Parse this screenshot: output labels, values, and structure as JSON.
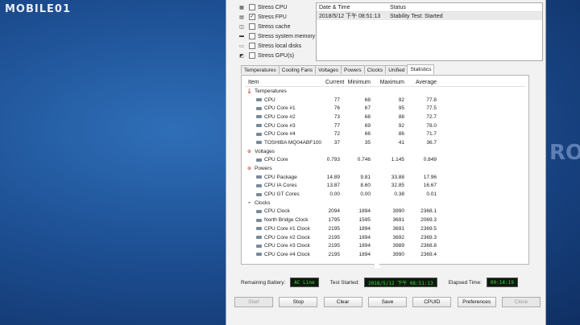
{
  "watermark": "MOBILE01",
  "bg_logo": "RO",
  "options": [
    {
      "label": "Stress CPU",
      "checked": false,
      "icon": "cpu-icon"
    },
    {
      "label": "Stress FPU",
      "checked": true,
      "icon": "fpu-icon"
    },
    {
      "label": "Stress cache",
      "checked": false,
      "icon": "cache-icon"
    },
    {
      "label": "Stress system memory",
      "checked": false,
      "icon": "memory-icon"
    },
    {
      "label": "Stress local disks",
      "checked": false,
      "icon": "disk-icon"
    },
    {
      "label": "Stress GPU(s)",
      "checked": false,
      "icon": "gpu-icon"
    }
  ],
  "log": {
    "col_date": "Date & Time",
    "col_status": "Status",
    "rows": [
      {
        "date": "2018/5/12 下午 08:51:13",
        "status": "Stability Test: Started"
      }
    ]
  },
  "tabs": [
    "Temperatures",
    "Cooling Fans",
    "Voltages",
    "Powers",
    "Clocks",
    "Unified",
    "Statistics"
  ],
  "active_tab": "Statistics",
  "table": {
    "headers": [
      "Item",
      "Current",
      "Minimum",
      "Maximum",
      "Average"
    ],
    "rows": [
      {
        "type": "group",
        "name": "Temperatures",
        "icon": "thermometer-icon"
      },
      {
        "type": "sensor",
        "name": "CPU",
        "cur": "77",
        "min": "68",
        "max": "92",
        "avg": "77.8"
      },
      {
        "type": "sensor",
        "name": "CPU Core #1",
        "cur": "76",
        "min": "67",
        "max": "95",
        "avg": "77.5"
      },
      {
        "type": "sensor",
        "name": "CPU Core #2",
        "cur": "73",
        "min": "68",
        "max": "88",
        "avg": "72.7"
      },
      {
        "type": "sensor",
        "name": "CPU Core #3",
        "cur": "77",
        "min": "69",
        "max": "92",
        "avg": "78.0"
      },
      {
        "type": "sensor",
        "name": "CPU Core #4",
        "cur": "72",
        "min": "66",
        "max": "86",
        "avg": "71.7"
      },
      {
        "type": "sensor",
        "name": "TOSHIBA MQ04ABF100",
        "cur": "37",
        "min": "35",
        "max": "41",
        "avg": "36.7"
      },
      {
        "type": "group",
        "name": "Voltages",
        "icon": "voltage-icon"
      },
      {
        "type": "sensor",
        "name": "CPU Core",
        "cur": "0.793",
        "min": "0.746",
        "max": "1.145",
        "avg": "0.849"
      },
      {
        "type": "group",
        "name": "Powers",
        "icon": "power-icon"
      },
      {
        "type": "sensor",
        "name": "CPU Package",
        "cur": "14.89",
        "min": "9.81",
        "max": "33.88",
        "avg": "17.96"
      },
      {
        "type": "sensor",
        "name": "CPU IA Cores",
        "cur": "13.87",
        "min": "8.60",
        "max": "32.85",
        "avg": "16.67"
      },
      {
        "type": "sensor",
        "name": "CPU GT Cores",
        "cur": "0.00",
        "min": "0.00",
        "max": "0.38",
        "avg": "0.01"
      },
      {
        "type": "group",
        "name": "Clocks",
        "icon": "clock-icon"
      },
      {
        "type": "sensor",
        "name": "CPU Clock",
        "cur": "2094",
        "min": "1894",
        "max": "3990",
        "avg": "2368.1"
      },
      {
        "type": "sensor",
        "name": "North Bridge Clock",
        "cur": "1795",
        "min": "1595",
        "max": "3691",
        "avg": "2069.3"
      },
      {
        "type": "sensor",
        "name": "CPU Core #1 Clock",
        "cur": "2195",
        "min": "1894",
        "max": "3691",
        "avg": "2369.5"
      },
      {
        "type": "sensor",
        "name": "CPU Core #2 Clock",
        "cur": "2195",
        "min": "1894",
        "max": "3692",
        "avg": "2369.3"
      },
      {
        "type": "sensor",
        "name": "CPU Core #3 Clock",
        "cur": "2195",
        "min": "1894",
        "max": "3989",
        "avg": "2368.8"
      },
      {
        "type": "sensor",
        "name": "CPU Core #4 Clock",
        "cur": "2195",
        "min": "1894",
        "max": "3990",
        "avg": "2369.4"
      }
    ]
  },
  "status": {
    "battery_label": "Remaining Battery:",
    "battery_value": "AC Line",
    "started_label": "Test Started:",
    "started_value": "2018/5/12 下午 08:51:13",
    "elapsed_label": "Elapsed Time:",
    "elapsed_value": "00:14:19"
  },
  "buttons": [
    {
      "label": "Start",
      "enabled": false
    },
    {
      "label": "Stop",
      "enabled": true
    },
    {
      "label": "Clear",
      "enabled": true
    },
    {
      "label": "Save",
      "enabled": true
    },
    {
      "label": "CPUID",
      "enabled": true
    },
    {
      "label": "Preferences",
      "enabled": true
    },
    {
      "label": "Close",
      "enabled": false
    }
  ]
}
